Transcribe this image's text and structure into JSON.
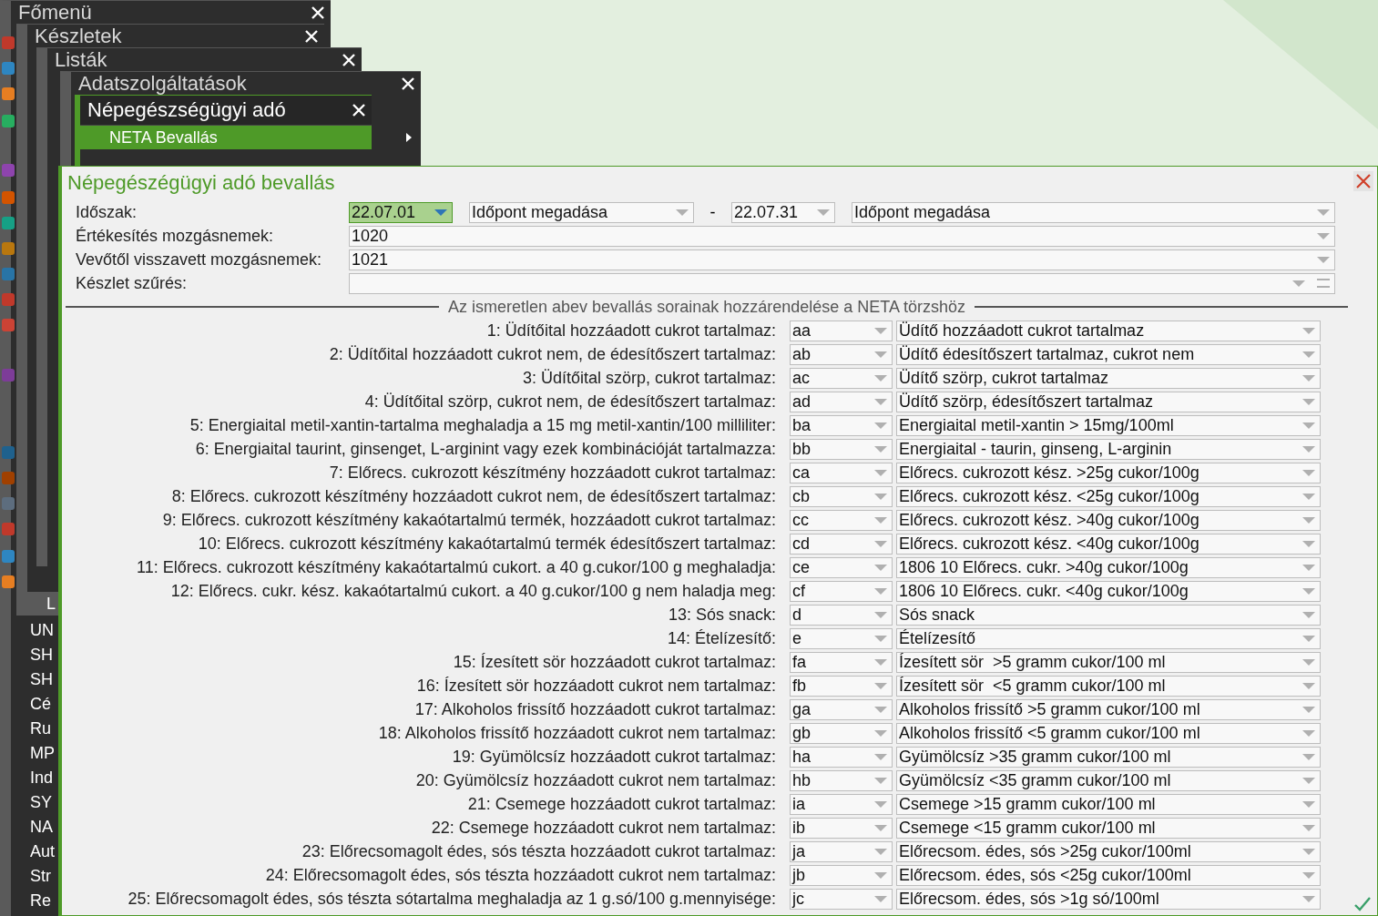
{
  "menus": [
    {
      "title": "Főmenü"
    },
    {
      "title": "Készletek"
    },
    {
      "title": "Listák"
    },
    {
      "title": "Adatszolgáltatások"
    },
    {
      "title": "Népegészségügyi adó",
      "items": [
        {
          "label": "NETA Bevallás",
          "selected": true,
          "has_submenu": true
        }
      ]
    }
  ],
  "side_list": {
    "header": "L",
    "items": [
      "UN",
      "SH",
      "SH",
      "Cé",
      "Ru",
      "MP",
      "Ind",
      "SY",
      "NA",
      "Aut",
      "Str",
      "Re"
    ]
  },
  "dialog": {
    "title": "Népegészégügyi adó bevallás",
    "filters": [
      {
        "kind": "period",
        "label": "Időszak:",
        "from": {
          "value": "22.07.01",
          "focused": true
        },
        "from_mode": "Időpont megadása",
        "separator": "-",
        "to": {
          "value": "22.07.31",
          "focused": false
        },
        "to_mode": "Időpont megadása"
      },
      {
        "kind": "combo",
        "label": "Értékesítés mozgásnemek:",
        "value": "1020"
      },
      {
        "kind": "combo",
        "label": "Vevőtől visszavett mozgásnemek:",
        "value": "1021"
      },
      {
        "kind": "filter",
        "label": "Készlet szűrés:"
      }
    ],
    "section_title": "Az ismeretlen abev bevallás sorainak hozzárendelése a NETA törzshöz",
    "rows": [
      {
        "label": "1: Üdítőital hozzáadott cukrot tartalmaz:",
        "code": "aa",
        "target": "Üdítő hozzáadott cukrot tartalmaz"
      },
      {
        "label": "2: Üdítőital hozzáadott cukrot nem, de édesítőszert tartalmaz:",
        "code": "ab",
        "target": "Üdítő édesítőszert tartalmaz, cukrot nem"
      },
      {
        "label": "3: Üdítőital szörp, cukrot tartalmaz:",
        "code": "ac",
        "target": "Üdítő szörp, cukrot tartalmaz"
      },
      {
        "label": "4: Üdítőital szörp, cukrot nem, de édesítőszert tartalmaz:",
        "code": "ad",
        "target": "Üdítő szörp, édesítőszert tartalmaz"
      },
      {
        "label": "5: Energiaital metil-xantin-tartalma meghaladja a 15 mg metil-xantin/100 milliliter:",
        "code": "ba",
        "target": "Energiaital metil-xantin > 15mg/100ml"
      },
      {
        "label": "6: Energiaital taurint, ginsenget, L-arginint vagy ezek kombinációját tartalmazza:",
        "code": "bb",
        "target": "Energiaital - taurin, ginseng, L-arginin"
      },
      {
        "label": "7: Előrecs. cukrozott készítmény hozzáadott cukrot tartalmaz:",
        "code": "ca",
        "target": "Előrecs. cukrozott kész. >25g cukor/100g"
      },
      {
        "label": "8: Előrecs. cukrozott készítmény hozzáadott cukrot nem, de édesítőszert tartalmaz:",
        "code": "cb",
        "target": "Előrecs. cukrozott kész. <25g cukor/100g"
      },
      {
        "label": "9: Előrecs. cukrozott készítmény kakaótartalmú termék, hozzáadott cukrot tartalmaz:",
        "code": "cc",
        "target": "Előrecs. cukrozott kész. >40g cukor/100g"
      },
      {
        "label": "10: Előrecs. cukrozott készítmény kakaótartalmú termék édesítőszert tartalmaz:",
        "code": "cd",
        "target": "Előrecs. cukrozott kész. <40g cukor/100g"
      },
      {
        "label": "11: Előrecs. cukrozott készítmény kakaótartalmú cukort. a 40 g.cukor/100 g meghaladja:",
        "code": "ce",
        "target": "1806 10 Előrecs. cukr. >40g cukor/100g"
      },
      {
        "label": "12: Előrecs. cukr. kész. kakaótartalmú cukort. a 40 g.cukor/100 g nem haladja meg:",
        "code": "cf",
        "target": "1806 10 Előrecs. cukr. <40g cukor/100g"
      },
      {
        "label": "13: Sós snack:",
        "code": "d",
        "target": "Sós snack"
      },
      {
        "label": "14: Ételízesítő:",
        "code": "e",
        "target": "Ételízesítő"
      },
      {
        "label": "15: Ízesített sör hozzáadott cukrot tartalmaz:",
        "code": "fa",
        "target": "Ízesített sör  >5 gramm cukor/100 ml"
      },
      {
        "label": "16: Ízesített sör hozzáadott cukrot nem tartalmaz:",
        "code": "fb",
        "target": "Ízesített sör  <5 gramm cukor/100 ml"
      },
      {
        "label": "17: Alkoholos frissítő hozzáadott cukrot tartalmaz:",
        "code": "ga",
        "target": "Alkoholos frissítő >5 gramm cukor/100 ml"
      },
      {
        "label": "18: Alkoholos frissítő hozzáadott cukrot nem tartalmaz:",
        "code": "gb",
        "target": "Alkoholos frissítő <5 gramm cukor/100 ml"
      },
      {
        "label": "19: Gyümölcsíz hozzáadott cukrot tartalmaz:",
        "code": "ha",
        "target": "Gyümölcsíz >35 gramm cukor/100 ml"
      },
      {
        "label": "20: Gyümölcsíz hozzáadott cukrot nem tartalmaz:",
        "code": "hb",
        "target": "Gyümölcsíz <35 gramm cukor/100 ml"
      },
      {
        "label": "21: Csemege hozzáadott cukrot tartalmaz:",
        "code": "ia",
        "target": "Csemege >15 gramm cukor/100 ml"
      },
      {
        "label": "22: Csemege hozzáadott cukrot nem tartalmaz:",
        "code": "ib",
        "target": "Csemege <15 gramm cukor/100 ml"
      },
      {
        "label": "23: Előrecsomagolt édes, sós tészta hozzáadott cukrot tartalmaz:",
        "code": "ja",
        "target": "Előrecsom. édes, sós >25g cukor/100ml"
      },
      {
        "label": "24: Előrecsomagolt édes, sós tészta hozzáadott cukrot nem tartalmaz:",
        "code": "jb",
        "target": "Előrecsom. édes, sós <25g cukor/100ml"
      },
      {
        "label": "25: Előrecsomagolt édes, sós tészta sótartalma meghaladja az 1 g.só/100 g.mennyisége:",
        "code": "jc",
        "target": "Előrecsom. édes, sós >1g só/100ml"
      }
    ]
  }
}
